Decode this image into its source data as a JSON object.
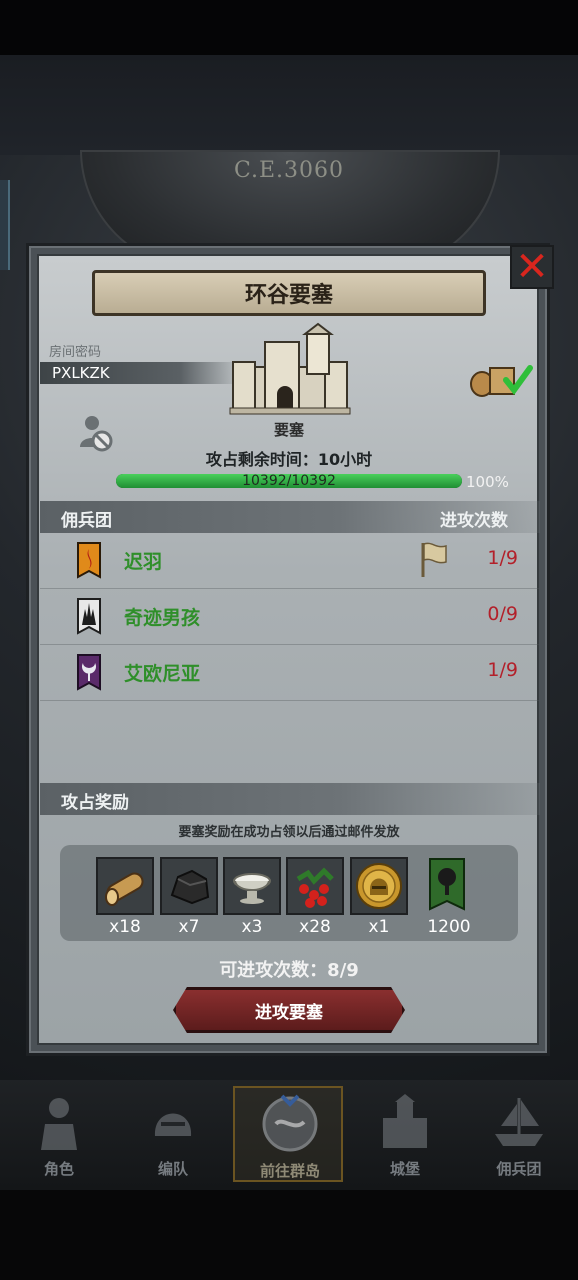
{
  "header": {
    "year": "C.E.3060"
  },
  "modal": {
    "title": "环谷要塞",
    "room_label": "房间密码",
    "room_code": "PXLKZK",
    "castle_label": "要塞",
    "time_remaining": "攻占剩余时间：10小时",
    "hp_text": "10392/10392",
    "hp_percent": "100%",
    "hp_fraction": 1.0,
    "close_icon": "close-icon",
    "mercenary_header": "佣兵团",
    "attack_count_header": "进攻次数",
    "guilds": [
      {
        "name": "迟羽",
        "attempts": "1/9",
        "banner": "orange-flame-banner",
        "has_flag": true
      },
      {
        "name": "奇迹男孩",
        "attempts": "0/9",
        "banner": "black-spire-banner",
        "has_flag": false
      },
      {
        "name": "艾欧尼亚",
        "attempts": "1/9",
        "banner": "purple-crescent-banner",
        "has_flag": false
      }
    ],
    "rewards_header": "攻占奖励",
    "reward_note": "要塞奖励在成功占领以后通过邮件发放",
    "rewards": [
      {
        "item": "wood-logs",
        "count": "x18"
      },
      {
        "item": "stone-ore",
        "count": "x7"
      },
      {
        "item": "silver-bowl",
        "count": "x3"
      },
      {
        "item": "berries",
        "count": "x28"
      },
      {
        "item": "gold-helmet-coin",
        "count": "x1"
      },
      {
        "item": "green-tree-banner",
        "count": "1200"
      }
    ],
    "attacks_left": "可进攻次数：8/9",
    "attack_button": "进攻要塞"
  },
  "nav": [
    {
      "label": "角色",
      "icon": "knight-icon"
    },
    {
      "label": "编队",
      "icon": "helmet-icon"
    },
    {
      "label": "前往群岛",
      "icon": "compass-map-icon",
      "active": true
    },
    {
      "label": "城堡",
      "icon": "castle-icon"
    },
    {
      "label": "佣兵团",
      "icon": "ship-icon"
    }
  ],
  "colors": {
    "guild_name": "#2f8f2a",
    "attempts": "#b3202a",
    "hp_bar": "#3fbf52",
    "attack_button": "#7a2828"
  }
}
